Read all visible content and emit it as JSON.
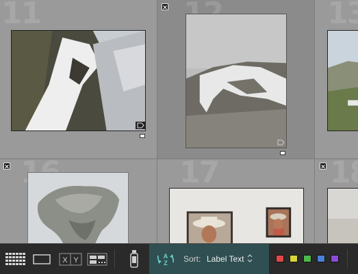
{
  "grid": {
    "cells": [
      {
        "number": "11"
      },
      {
        "number": "12"
      },
      {
        "number": "13"
      },
      {
        "number": "16"
      },
      {
        "number": "17"
      },
      {
        "number": "18"
      }
    ]
  },
  "toolbar": {
    "grid_view_icon": "grid-view-icon",
    "loupe_view_icon": "loupe-view-icon",
    "compare_view_label": "X|Y",
    "survey_view_icon": "survey-view-icon",
    "spray_can_icon": "painter-spray-can-icon",
    "sort_icon_label": "AZ",
    "sort_label": "Sort:",
    "sort_value": "Label Text",
    "sort_caret": "⌃⌄",
    "color_labels": [
      {
        "name": "red",
        "color": "#e0484a"
      },
      {
        "name": "yellow",
        "color": "#d9d43a"
      },
      {
        "name": "green",
        "color": "#4fb84a"
      },
      {
        "name": "blue",
        "color": "#4a80d8"
      },
      {
        "name": "purple",
        "color": "#8d4ad8"
      }
    ]
  }
}
